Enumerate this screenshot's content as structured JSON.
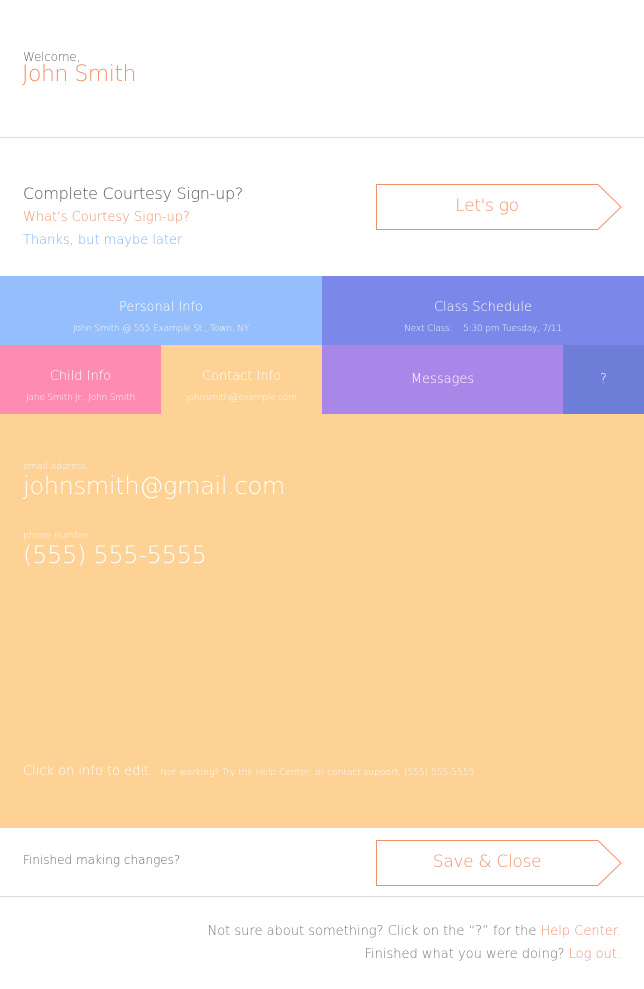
{
  "header": {
    "welcome": "Welcome,",
    "user_name": "John Smith"
  },
  "signup": {
    "title": "Complete Courtesy Sign-up?",
    "what_link": "What's Courtesy Sign-up?",
    "later_link": "Thanks, but maybe later",
    "button_label": "Let's go"
  },
  "tiles": {
    "personal_info": {
      "title": "Personal Info",
      "subtitle": "John Smith @ 555 Example St., Town, NY"
    },
    "class_schedule": {
      "title": "Class Schedule",
      "subtitle": "Next Class:    5:30 pm Tuesday, 7/11"
    },
    "child_info": {
      "title": "Child Info",
      "subtitle": "Jane Smith Jr., John Smith"
    },
    "contact_info": {
      "title": "Contact Info",
      "subtitle": "johnsmith@example.com"
    },
    "messages": {
      "title": "Messages"
    },
    "help": {
      "title": "?"
    }
  },
  "contact_panel": {
    "email_label": "email address",
    "email_value": "johnsmith@gmail.com",
    "phone_label": "phone number",
    "phone_value": "(555) 555-5555",
    "hint_main": "Click on info to edit.",
    "hint_sub": "Not working? Try the Help Center, or contact support, (555) 555-5555"
  },
  "save_row": {
    "question": "Finished making changes?",
    "button_label": "Save & Close"
  },
  "footer": {
    "line1_text": "Not sure about something? Click on the “?” for the ",
    "help_link": "Help Center.",
    "line2_text": "Finished what you were doing? ",
    "logout_link": "Log out."
  },
  "colors": {
    "accent": "#f0906a",
    "personal_info": "#94bffc",
    "class_schedule": "#7b88ea",
    "child_info": "#fe8bb2",
    "contact_info": "#fed194",
    "messages": "#a987e8",
    "help": "#6f7ed9",
    "link_blue": "#7ab1f2"
  }
}
